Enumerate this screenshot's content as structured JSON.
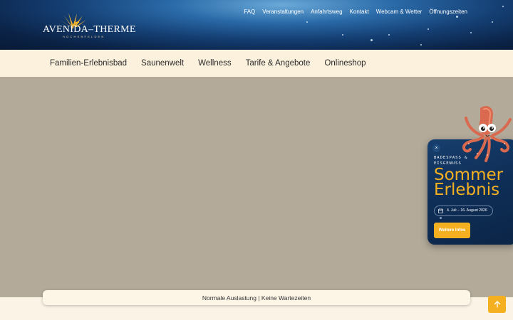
{
  "brand": {
    "logo_text": "AVENIDA–THERME",
    "logo_subtext": "HOCHENFELDEN"
  },
  "topnav": {
    "items": [
      "FAQ",
      "Veranstaltungen",
      "Anfahrtsweg",
      "Kontakt",
      "Webcam & Wetter",
      "Öffnungszeiten"
    ]
  },
  "mainnav": {
    "items": [
      "Familien-Erlebnisbad",
      "Saunenwelt",
      "Wellness",
      "Tarife & Angebote",
      "Onlineshop"
    ]
  },
  "status": {
    "text": "Normale Auslastung | Keine Wartezeiten"
  },
  "promo": {
    "close_label": "×",
    "kicker": "BADESPASS & EISGENUSS",
    "title": "Sommer Erlebnis",
    "date": "4. Juli – 16. August 2026",
    "button": "Weitere Infos",
    "accent_color": "#f5b021"
  },
  "icons": {
    "calendar": "calendar-icon",
    "close": "close-icon",
    "back_to_top": "arrow-up-icon"
  }
}
